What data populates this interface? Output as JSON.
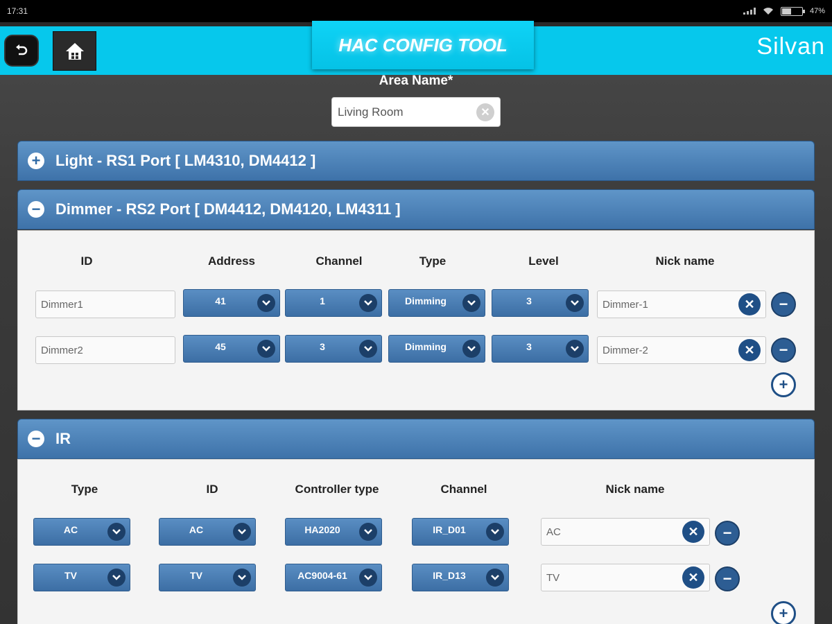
{
  "status": {
    "time": "17:31",
    "battery": "47%"
  },
  "header": {
    "title": "HAC CONFIG TOOL",
    "brand": "Silvan"
  },
  "area": {
    "label": "Area Name*",
    "value": "Living Room"
  },
  "panels": {
    "light": {
      "title": "Light - RS1 Port [ LM4310, DM4412 ]",
      "icon": "+"
    },
    "dimmer": {
      "title": "Dimmer - RS2 Port [ DM4412, DM4120, LM4311 ]",
      "icon": "−",
      "columns": [
        "ID",
        "Address",
        "Channel",
        "Type",
        "Level",
        "Nick name"
      ],
      "rows": [
        {
          "id": "Dimmer1",
          "address": "41",
          "channel": "1",
          "type": "Dimming",
          "level": "3",
          "nick": "Dimmer-1"
        },
        {
          "id": "Dimmer2",
          "address": "45",
          "channel": "3",
          "type": "Dimming",
          "level": "3",
          "nick": "Dimmer-2"
        }
      ]
    },
    "ir": {
      "title": "IR",
      "icon": "−",
      "columns": [
        "Type",
        "ID",
        "Controller type",
        "Channel",
        "Nick name"
      ],
      "rows": [
        {
          "type": "AC",
          "id": "AC",
          "controller": "HA2020",
          "channel": "IR_D01",
          "nick": "AC"
        },
        {
          "type": "TV",
          "id": "TV",
          "controller": "AC9004-61",
          "channel": "IR_D13",
          "nick": "TV"
        }
      ]
    }
  },
  "colors": {
    "header": "#06c8ec",
    "panel": "#3e72a9",
    "dark_button": "#1f4f86"
  },
  "icons": {
    "back": "back-arrow-icon",
    "home": "home-icon",
    "clear": "close-icon",
    "dropdown": "chevron-down-icon",
    "remove": "minus-icon",
    "add": "plus-icon"
  }
}
